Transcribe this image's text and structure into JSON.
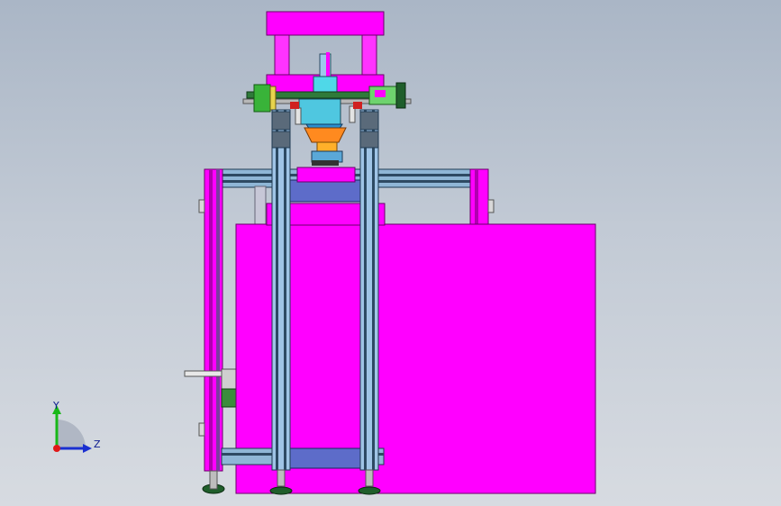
{
  "viewport": {
    "background_top": "#aab6c6",
    "background_bottom": "#d7dbe1"
  },
  "colors": {
    "magenta": "#ff00ff",
    "magenta_dark": "#b000b0",
    "profile_blue": "#9fc4e6",
    "profile_dark": "#2d4a63",
    "green": "#3fa33f",
    "orange": "#ff8a1f",
    "cyan": "#4fd8e8",
    "dark_green": "#1f5e2b"
  },
  "triad": {
    "y_label": "Y",
    "z_label": "Z",
    "x_color": "#e01818",
    "y_color": "#18b818",
    "z_color": "#1a2fd0"
  }
}
